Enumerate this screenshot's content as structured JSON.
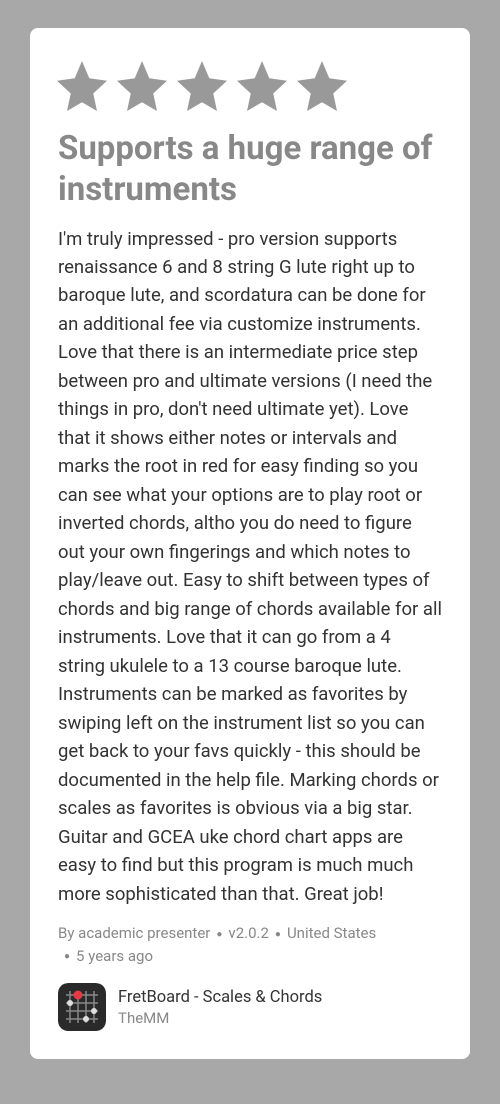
{
  "review": {
    "rating": 5,
    "title": "Supports a huge range of instruments",
    "body": "I'm truly impressed - pro version supports renaissance 6 and 8 string G lute right up to baroque lute, and scordatura can be done for an additional fee via customize instruments. Love that there is an intermediate price step between pro and ultimate versions (I need the things in pro, don't need ultimate yet). Love that it shows either notes or intervals and marks the root in red for easy finding so you can see what your options are to play root or inverted chords, altho you do need to figure out your own fingerings and which notes to play/leave out. Easy to shift between types of chords and big range of chords available for all instruments. Love that it can go from a 4 string ukulele to a 13 course baroque lute. Instruments can be marked as favorites by swiping left on the instrument list so you can get back to your favs quickly - this should be documented in the help file. Marking chords or scales as favorites is obvious via a big star. Guitar and GCEA uke chord chart apps are easy to find but this program is much much more sophisticated than that. Great job!",
    "author_prefix": "By ",
    "author": "academic presenter",
    "version": "v2.0.2",
    "country": "United States",
    "age": "5 years ago"
  },
  "app": {
    "name": "FretBoard - Scales & Chords",
    "publisher": "TheMM"
  }
}
